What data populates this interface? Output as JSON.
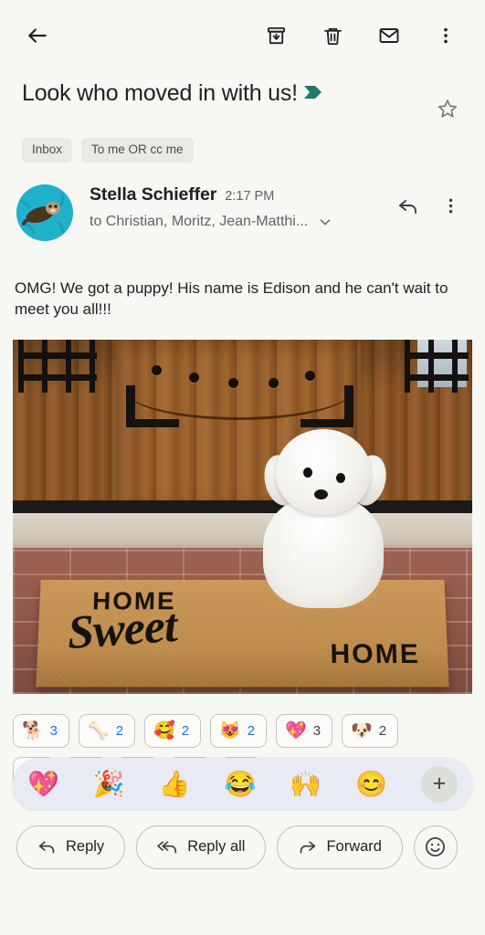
{
  "toolbar": {
    "back_label": "Back",
    "archive_label": "Archive",
    "delete_label": "Delete",
    "mark_unread_label": "Mark as unread",
    "more_label": "More options"
  },
  "subject": {
    "text": "Look who moved in with us!",
    "importance_marker": "chevron-marker",
    "starred": false,
    "labels": [
      "Inbox",
      "To me OR cc me"
    ]
  },
  "message": {
    "sender_name": "Stella Schieffer",
    "time": "2:17 PM",
    "recipients": "to Christian, Moritz, Jean-Matthi...",
    "avatar_alt": "sea-otter-avatar",
    "reply_icon_label": "Reply",
    "more_icon_label": "More options",
    "body": "OMG! We got a puppy! His name is Edison and he can't wait to meet you all!!!"
  },
  "attachment": {
    "alt": "White puppy sitting on a HOME SWEET HOME doormat in front of a wooden front door",
    "mat_word_1": "HOME",
    "mat_word_2": "Sweet",
    "mat_word_3": "HOME"
  },
  "reactions": {
    "row1": [
      {
        "emoji": "🐕",
        "name": "dog",
        "count": "3",
        "self": true
      },
      {
        "emoji": "🦴",
        "name": "bone",
        "count": "2",
        "self": true
      },
      {
        "emoji": "🥰",
        "name": "smiling-face-with-hearts",
        "count": "2",
        "self": true
      },
      {
        "emoji": "😻",
        "name": "heart-eyes-cat",
        "count": "2",
        "self": true
      },
      {
        "emoji": "💖",
        "name": "sparkling-heart",
        "count": "3",
        "self": false
      },
      {
        "emoji": "🐶",
        "name": "dog-face",
        "count": "2",
        "self": false
      }
    ],
    "row2": [
      {
        "emoji": "🥇",
        "name": "reaction-partial-1",
        "count": "",
        "self": false
      },
      {
        "emoji": "🍕",
        "name": "reaction-partial-2",
        "count": "",
        "self": false
      },
      {
        "emoji": "💧",
        "name": "reaction-partial-3",
        "count": "",
        "self": false
      },
      {
        "emoji": "🦋",
        "name": "reaction-partial-4",
        "count": "",
        "self": false
      },
      {
        "emoji": "😐",
        "name": "reaction-partial-5",
        "count": "",
        "self": false
      }
    ]
  },
  "picker": {
    "emojis": [
      {
        "emoji": "💖",
        "name": "sparkling-heart"
      },
      {
        "emoji": "🎉",
        "name": "party-popper"
      },
      {
        "emoji": "👍",
        "name": "thumbs-up"
      },
      {
        "emoji": "😂",
        "name": "face-with-tears-of-joy"
      },
      {
        "emoji": "🙌",
        "name": "raising-hands"
      },
      {
        "emoji": "😊",
        "name": "smiling-face-with-smiling-eyes"
      }
    ],
    "plus_label": "+"
  },
  "actions": {
    "reply": "Reply",
    "reply_all": "Reply all",
    "forward": "Forward",
    "emoji_button_label": "Add reaction"
  },
  "colors": {
    "background": "#f7f8f4",
    "accent_blue": "#1a73e8",
    "importance_teal": "#1f7a6e",
    "picker_bg": "#e8eaf4",
    "chip_border": "#c3c7c1"
  }
}
